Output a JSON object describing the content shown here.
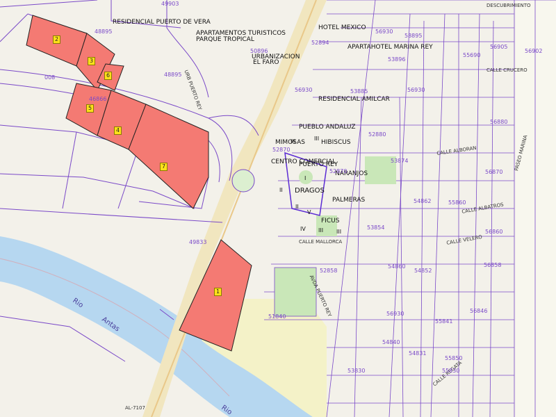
{
  "map": {
    "labels": [
      {
        "id": "res-puerto-vera",
        "text": "RESIDENCIAL PUERTO DE VERA",
        "style": "blk"
      },
      {
        "id": "apt-turisticos",
        "text": "APARTAMENTOS TURISTICOS",
        "style": "blk"
      },
      {
        "id": "parque-tropical",
        "text": "PARQUE TROPICAL",
        "style": "blk"
      },
      {
        "id": "urbanizacion",
        "text": "URBANIZACION",
        "style": "blk"
      },
      {
        "id": "el-faro",
        "text": "EL FARO",
        "style": "blk"
      },
      {
        "id": "hotel-mexico",
        "text": "HOTEL MEXICO",
        "style": "blk"
      },
      {
        "id": "aparthotel",
        "text": "APARTAHOTEL MARINA REY",
        "style": "blk"
      },
      {
        "id": "res-amilcar",
        "text": "RESIDENCIAL AMILCAR",
        "style": "blk"
      },
      {
        "id": "pueblo-andaluz",
        "text": "PUEBLO ANDALUZ",
        "style": "blk"
      },
      {
        "id": "hibiscus",
        "text": "HIBISCUS",
        "style": "blk"
      },
      {
        "id": "mimosas",
        "text": "MIMOSAS",
        "style": "blk"
      },
      {
        "id": "centro-comercial",
        "text": "CENTRO COMERCIAL",
        "style": "blk"
      },
      {
        "id": "puerto-rey",
        "text": "PUERTO REY",
        "style": "blk"
      },
      {
        "id": "naranjos",
        "text": "NARANJOS",
        "style": "blk"
      },
      {
        "id": "dragos",
        "text": "DRAGOS",
        "style": "blk-lg"
      },
      {
        "id": "palmeras",
        "text": "PALMERAS",
        "style": "blk"
      },
      {
        "id": "ficus",
        "text": "FICUS",
        "style": "blk"
      },
      {
        "id": "c-descubrimiento",
        "text": "DESCUBRIMIENTO",
        "style": "street"
      },
      {
        "id": "c-crucero",
        "text": "CALLE CRUCERO",
        "style": "street"
      },
      {
        "id": "c-alboran",
        "text": "CALLE ALBORAN",
        "style": "street"
      },
      {
        "id": "c-albatros",
        "text": "CALLE ALBATROS",
        "style": "street"
      },
      {
        "id": "c-velero",
        "text": "CALLE VELERO",
        "style": "street"
      },
      {
        "id": "c-mallorca",
        "text": "CALLE MALLORCA",
        "style": "street"
      },
      {
        "id": "c-regata",
        "text": "CALLE REGATA",
        "style": "street"
      },
      {
        "id": "urb-puerto-rey",
        "text": "URB PUERTO REY",
        "style": "street"
      },
      {
        "id": "avda-puerto-rey",
        "text": "AVDA PUERTO REY",
        "style": "street"
      },
      {
        "id": "paseo-marina",
        "text": "PASEO MARINA",
        "style": "street"
      },
      {
        "id": "road-al-7107",
        "text": "AL-7107",
        "style": "street"
      },
      {
        "id": "n49903",
        "text": "49903",
        "style": "pur"
      },
      {
        "id": "n48895a",
        "text": "48895",
        "style": "pur"
      },
      {
        "id": "n48895b",
        "text": "48895",
        "style": "pur"
      },
      {
        "id": "n008",
        "text": "008",
        "style": "pur"
      },
      {
        "id": "n46866",
        "text": "46866",
        "style": "pur"
      },
      {
        "id": "n50896",
        "text": "50896",
        "style": "pur"
      },
      {
        "id": "n52894",
        "text": "52894",
        "style": "pur"
      },
      {
        "id": "n56930a",
        "text": "56930",
        "style": "pur"
      },
      {
        "id": "n56930b",
        "text": "56930",
        "style": "pur"
      },
      {
        "id": "n56930c",
        "text": "56930",
        "style": "pur"
      },
      {
        "id": "n58895",
        "text": "58895",
        "style": "pur"
      },
      {
        "id": "n53896",
        "text": "53896",
        "style": "pur"
      },
      {
        "id": "n52870a",
        "text": "52870",
        "style": "pur"
      },
      {
        "id": "n52870b",
        "text": "52870",
        "style": "pur"
      },
      {
        "id": "n53874",
        "text": "53874",
        "style": "pur"
      },
      {
        "id": "n54862",
        "text": "54862",
        "style": "pur"
      },
      {
        "id": "n55860",
        "text": "55860",
        "style": "pur"
      },
      {
        "id": "n56905",
        "text": "56905",
        "style": "pur"
      },
      {
        "id": "n56902",
        "text": "56902",
        "style": "pur"
      },
      {
        "id": "n56870",
        "text": "56870",
        "style": "pur"
      },
      {
        "id": "n56880",
        "text": "56880",
        "style": "pur"
      },
      {
        "id": "n56860",
        "text": "56860",
        "style": "pur"
      },
      {
        "id": "n49833",
        "text": "49833",
        "style": "pur"
      },
      {
        "id": "n52858",
        "text": "52858",
        "style": "pur"
      },
      {
        "id": "n51840",
        "text": "51840",
        "style": "pur"
      },
      {
        "id": "n54840",
        "text": "54840",
        "style": "pur"
      },
      {
        "id": "n54852",
        "text": "54852",
        "style": "pur"
      },
      {
        "id": "n54860",
        "text": "54860",
        "style": "pur"
      },
      {
        "id": "n55850",
        "text": "55850",
        "style": "pur"
      },
      {
        "id": "n55841",
        "text": "55841",
        "style": "pur"
      },
      {
        "id": "n56858",
        "text": "56858",
        "style": "pur"
      },
      {
        "id": "n56846",
        "text": "56846",
        "style": "pur"
      },
      {
        "id": "n53830",
        "text": "53830",
        "style": "pur"
      },
      {
        "id": "n54831",
        "text": "54831",
        "style": "pur"
      },
      {
        "id": "n55830",
        "text": "55830",
        "style": "pur"
      },
      {
        "id": "n56930d",
        "text": "56930",
        "style": "pur"
      },
      {
        "id": "n55690",
        "text": "55690",
        "style": "pur"
      },
      {
        "id": "n53854",
        "text": "53854",
        "style": "pur"
      },
      {
        "id": "n53885",
        "text": "53885",
        "style": "pur"
      },
      {
        "id": "n52880",
        "text": "52880",
        "style": "pur"
      },
      {
        "id": "river-rio-1",
        "text": "Rio",
        "style": "river"
      },
      {
        "id": "river-antas",
        "text": "Antas",
        "style": "river"
      },
      {
        "id": "river-rio-2",
        "text": "Rio",
        "style": "river"
      }
    ],
    "romans": [
      "I",
      "II",
      "III",
      "III",
      "IV",
      "V",
      "III",
      "II",
      "III"
    ],
    "parcels": [
      {
        "id": "1",
        "label": "1"
      },
      {
        "id": "2",
        "label": "2"
      },
      {
        "id": "3",
        "label": "3"
      },
      {
        "id": "4",
        "label": "4"
      },
      {
        "id": "5",
        "label": "5"
      },
      {
        "id": "6",
        "label": "6"
      },
      {
        "id": "7",
        "label": "7"
      }
    ]
  },
  "colors": {
    "background": "#f3f1ea",
    "parcel_fill": "#f47a73",
    "river": "#b6d7f0",
    "cadastre_line": "#7a49c8",
    "badge": "#ffe11a",
    "green_area": "#c9e7b8"
  }
}
